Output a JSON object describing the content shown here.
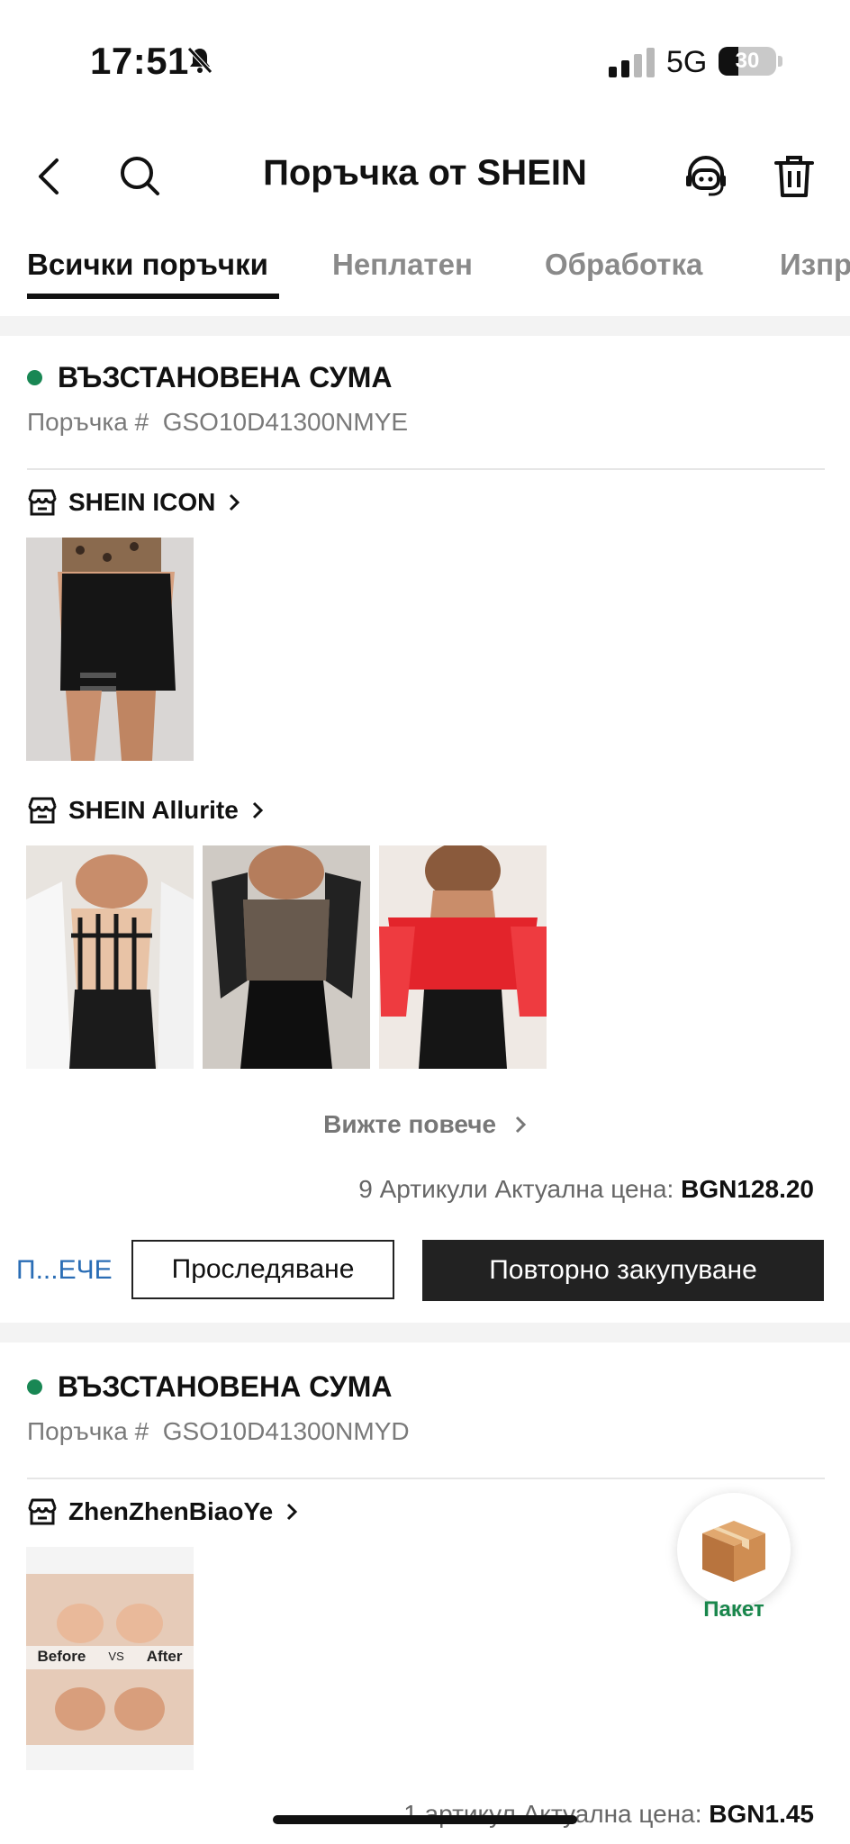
{
  "status_bar": {
    "time": "17:51",
    "network": "5G",
    "battery": "30"
  },
  "nav": {
    "title": "Поръчка от SHEIN"
  },
  "tabs": [
    "Всички поръчки",
    "Неплатен",
    "Обработка",
    "Изпр"
  ],
  "orders": [
    {
      "status": "ВЪЗСТАНОВЕНА СУМА",
      "order_label": "Поръчка #",
      "order_number": "GSO10D41300NMYE",
      "stores": [
        {
          "name": "SHEIN ICON"
        },
        {
          "name": "SHEIN Allurite"
        }
      ],
      "see_more": "Вижте повече",
      "summary_text": "9 Артикули Актуална цена:",
      "summary_price": "BGN128.20",
      "more_link": "П...ЕЧЕ",
      "track_button": "Проследяване",
      "rebuy_button": "Повторно закупуване"
    },
    {
      "status": "ВЪЗСТАНОВЕНА СУМА",
      "order_label": "Поръчка #",
      "order_number": "GSO10D41300NMYD",
      "stores": [
        {
          "name": "ZhenZhenBiaoYe"
        }
      ],
      "product_text": {
        "before": "Before",
        "vs": "VS",
        "after": "After"
      },
      "summary_text": "1 артикул Актуална цена:",
      "summary_price": "BGN1.45"
    }
  ],
  "package_button": {
    "label": "Пакет"
  },
  "colors": {
    "status_green": "#198754",
    "link_blue": "#2a6db5",
    "package_green": "#18864b"
  }
}
